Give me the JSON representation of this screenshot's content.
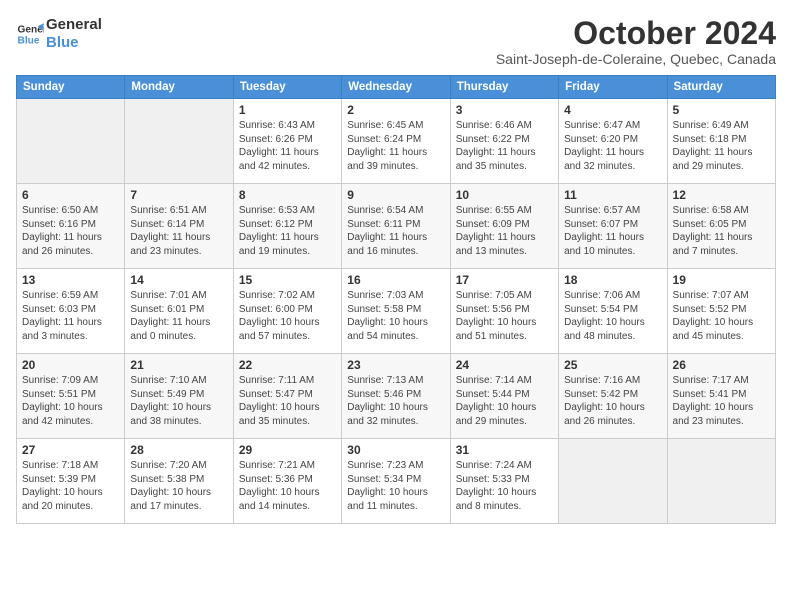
{
  "header": {
    "logo_line1": "General",
    "logo_line2": "Blue",
    "month": "October 2024",
    "location": "Saint-Joseph-de-Coleraine, Quebec, Canada"
  },
  "days_of_week": [
    "Sunday",
    "Monday",
    "Tuesday",
    "Wednesday",
    "Thursday",
    "Friday",
    "Saturday"
  ],
  "weeks": [
    [
      {
        "day": "",
        "info": ""
      },
      {
        "day": "",
        "info": ""
      },
      {
        "day": "1",
        "info": "Sunrise: 6:43 AM\nSunset: 6:26 PM\nDaylight: 11 hours and 42 minutes."
      },
      {
        "day": "2",
        "info": "Sunrise: 6:45 AM\nSunset: 6:24 PM\nDaylight: 11 hours and 39 minutes."
      },
      {
        "day": "3",
        "info": "Sunrise: 6:46 AM\nSunset: 6:22 PM\nDaylight: 11 hours and 35 minutes."
      },
      {
        "day": "4",
        "info": "Sunrise: 6:47 AM\nSunset: 6:20 PM\nDaylight: 11 hours and 32 minutes."
      },
      {
        "day": "5",
        "info": "Sunrise: 6:49 AM\nSunset: 6:18 PM\nDaylight: 11 hours and 29 minutes."
      }
    ],
    [
      {
        "day": "6",
        "info": "Sunrise: 6:50 AM\nSunset: 6:16 PM\nDaylight: 11 hours and 26 minutes."
      },
      {
        "day": "7",
        "info": "Sunrise: 6:51 AM\nSunset: 6:14 PM\nDaylight: 11 hours and 23 minutes."
      },
      {
        "day": "8",
        "info": "Sunrise: 6:53 AM\nSunset: 6:12 PM\nDaylight: 11 hours and 19 minutes."
      },
      {
        "day": "9",
        "info": "Sunrise: 6:54 AM\nSunset: 6:11 PM\nDaylight: 11 hours and 16 minutes."
      },
      {
        "day": "10",
        "info": "Sunrise: 6:55 AM\nSunset: 6:09 PM\nDaylight: 11 hours and 13 minutes."
      },
      {
        "day": "11",
        "info": "Sunrise: 6:57 AM\nSunset: 6:07 PM\nDaylight: 11 hours and 10 minutes."
      },
      {
        "day": "12",
        "info": "Sunrise: 6:58 AM\nSunset: 6:05 PM\nDaylight: 11 hours and 7 minutes."
      }
    ],
    [
      {
        "day": "13",
        "info": "Sunrise: 6:59 AM\nSunset: 6:03 PM\nDaylight: 11 hours and 3 minutes."
      },
      {
        "day": "14",
        "info": "Sunrise: 7:01 AM\nSunset: 6:01 PM\nDaylight: 11 hours and 0 minutes."
      },
      {
        "day": "15",
        "info": "Sunrise: 7:02 AM\nSunset: 6:00 PM\nDaylight: 10 hours and 57 minutes."
      },
      {
        "day": "16",
        "info": "Sunrise: 7:03 AM\nSunset: 5:58 PM\nDaylight: 10 hours and 54 minutes."
      },
      {
        "day": "17",
        "info": "Sunrise: 7:05 AM\nSunset: 5:56 PM\nDaylight: 10 hours and 51 minutes."
      },
      {
        "day": "18",
        "info": "Sunrise: 7:06 AM\nSunset: 5:54 PM\nDaylight: 10 hours and 48 minutes."
      },
      {
        "day": "19",
        "info": "Sunrise: 7:07 AM\nSunset: 5:52 PM\nDaylight: 10 hours and 45 minutes."
      }
    ],
    [
      {
        "day": "20",
        "info": "Sunrise: 7:09 AM\nSunset: 5:51 PM\nDaylight: 10 hours and 42 minutes."
      },
      {
        "day": "21",
        "info": "Sunrise: 7:10 AM\nSunset: 5:49 PM\nDaylight: 10 hours and 38 minutes."
      },
      {
        "day": "22",
        "info": "Sunrise: 7:11 AM\nSunset: 5:47 PM\nDaylight: 10 hours and 35 minutes."
      },
      {
        "day": "23",
        "info": "Sunrise: 7:13 AM\nSunset: 5:46 PM\nDaylight: 10 hours and 32 minutes."
      },
      {
        "day": "24",
        "info": "Sunrise: 7:14 AM\nSunset: 5:44 PM\nDaylight: 10 hours and 29 minutes."
      },
      {
        "day": "25",
        "info": "Sunrise: 7:16 AM\nSunset: 5:42 PM\nDaylight: 10 hours and 26 minutes."
      },
      {
        "day": "26",
        "info": "Sunrise: 7:17 AM\nSunset: 5:41 PM\nDaylight: 10 hours and 23 minutes."
      }
    ],
    [
      {
        "day": "27",
        "info": "Sunrise: 7:18 AM\nSunset: 5:39 PM\nDaylight: 10 hours and 20 minutes."
      },
      {
        "day": "28",
        "info": "Sunrise: 7:20 AM\nSunset: 5:38 PM\nDaylight: 10 hours and 17 minutes."
      },
      {
        "day": "29",
        "info": "Sunrise: 7:21 AM\nSunset: 5:36 PM\nDaylight: 10 hours and 14 minutes."
      },
      {
        "day": "30",
        "info": "Sunrise: 7:23 AM\nSunset: 5:34 PM\nDaylight: 10 hours and 11 minutes."
      },
      {
        "day": "31",
        "info": "Sunrise: 7:24 AM\nSunset: 5:33 PM\nDaylight: 10 hours and 8 minutes."
      },
      {
        "day": "",
        "info": ""
      },
      {
        "day": "",
        "info": ""
      }
    ]
  ]
}
